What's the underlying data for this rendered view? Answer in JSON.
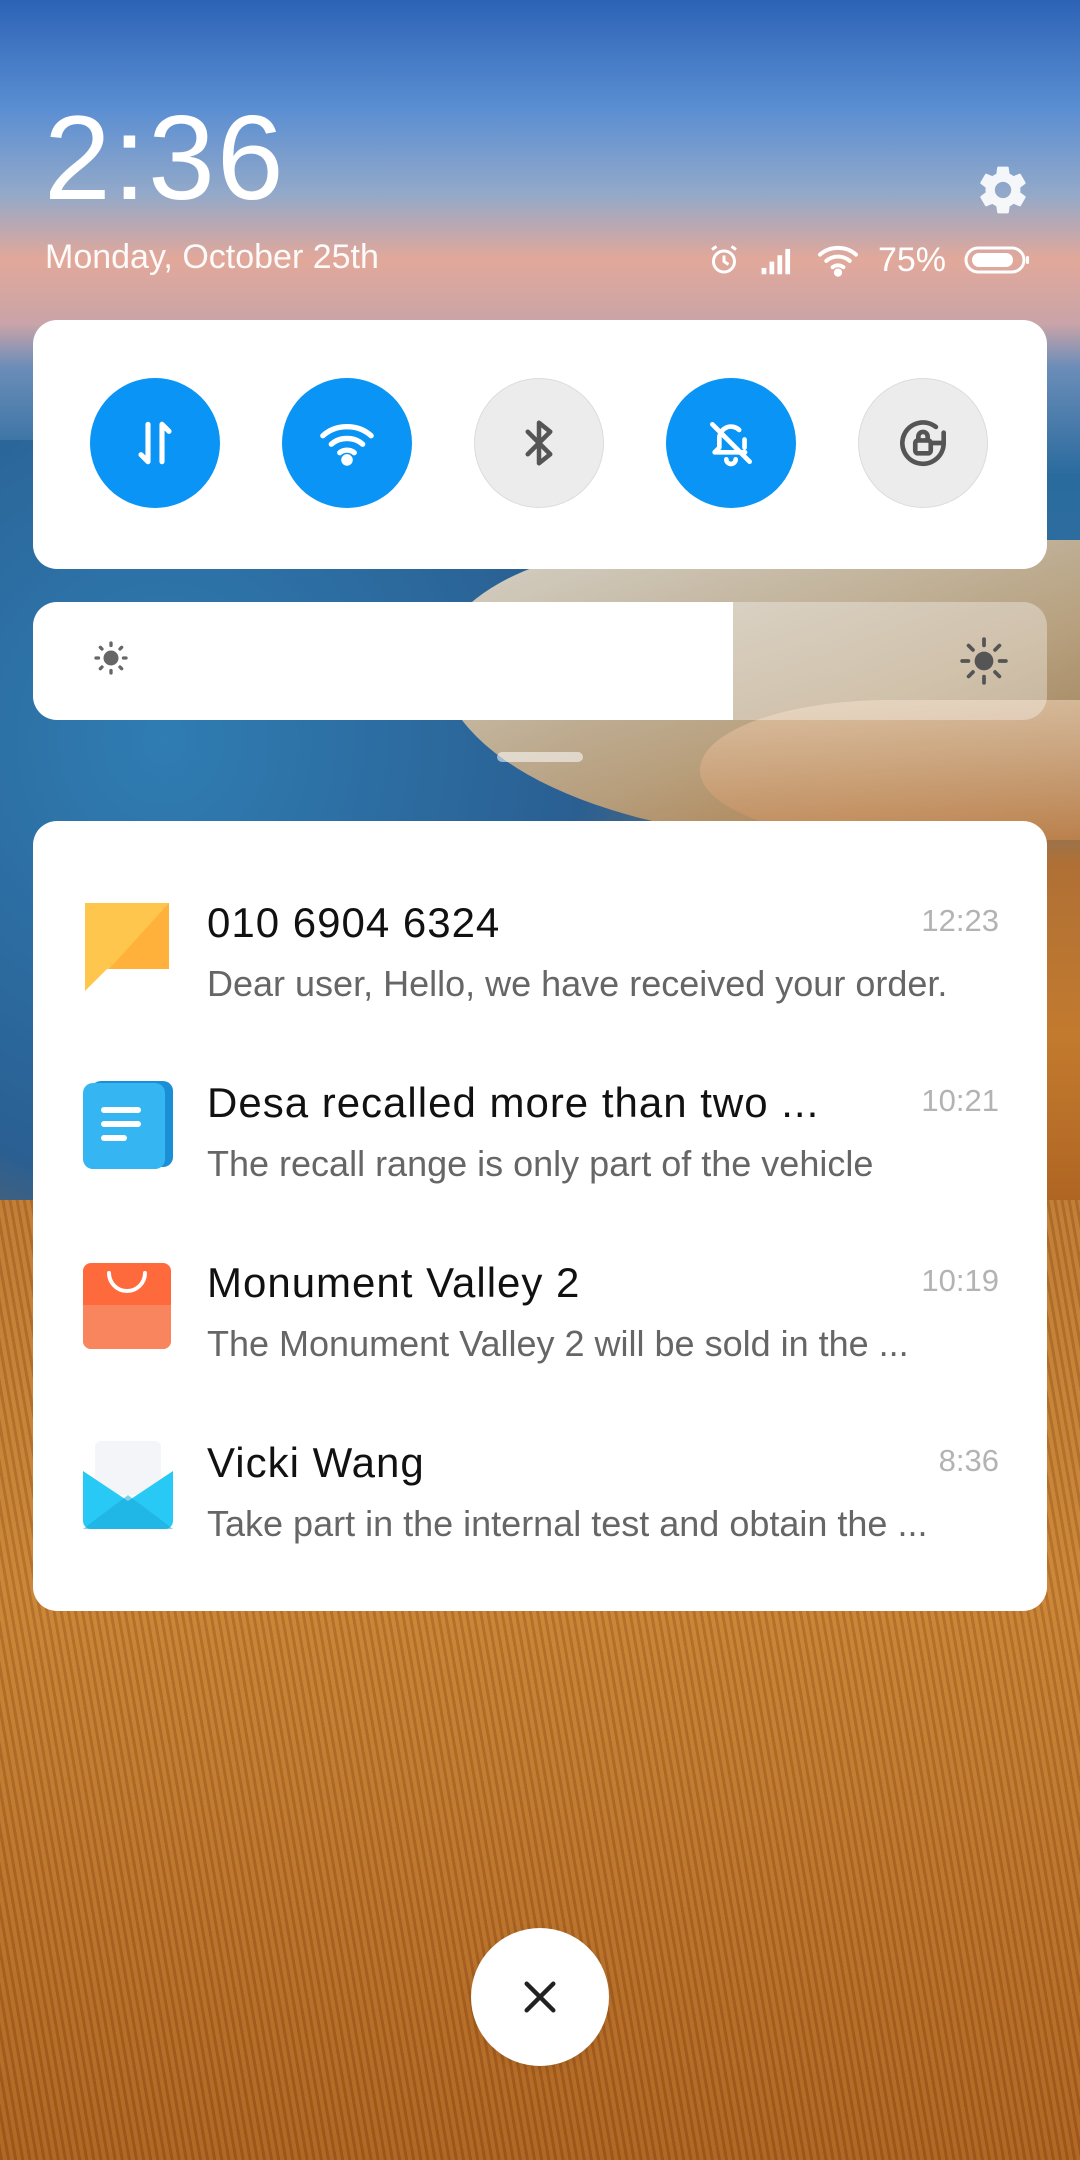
{
  "header": {
    "time": "2:36",
    "date": "Monday, October 25th",
    "battery_percent": "75%",
    "battery_level": 0.75
  },
  "icons": {
    "settings": "gear-icon",
    "alarm": "alarm-icon",
    "signal": "signal-icon",
    "wifi": "wifi-icon",
    "battery": "battery-icon"
  },
  "quick_toggles": [
    {
      "name": "mobile-data",
      "icon": "data-arrows-icon",
      "state": "on"
    },
    {
      "name": "wifi",
      "icon": "wifi-icon",
      "state": "on"
    },
    {
      "name": "bluetooth",
      "icon": "bluetooth-icon",
      "state": "off"
    },
    {
      "name": "mute",
      "icon": "bell-off-icon",
      "state": "on"
    },
    {
      "name": "rotation-lock",
      "icon": "rotation-lock-icon",
      "state": "off"
    }
  ],
  "brightness": {
    "level": 0.69
  },
  "colors": {
    "accent": "#0a94f5"
  },
  "notifications": [
    {
      "icon": "messages-icon",
      "title": "010  6904  6324",
      "body": "Dear user, Hello, we have received your order.",
      "time": "12:23"
    },
    {
      "icon": "notes-icon",
      "title": "Desa  recalled  more  than  two  ...",
      "body": "The recall range is only part of the vehicle",
      "time": "10:21"
    },
    {
      "icon": "shopping-bag-icon",
      "title": "Monument  Valley  2",
      "body": "The Monument Valley 2 will be sold in the ...",
      "time": "10:19"
    },
    {
      "icon": "mail-icon",
      "title": "Vicki  Wang",
      "body": "Take part in the internal test and obtain the ...",
      "time": "8:36"
    }
  ]
}
